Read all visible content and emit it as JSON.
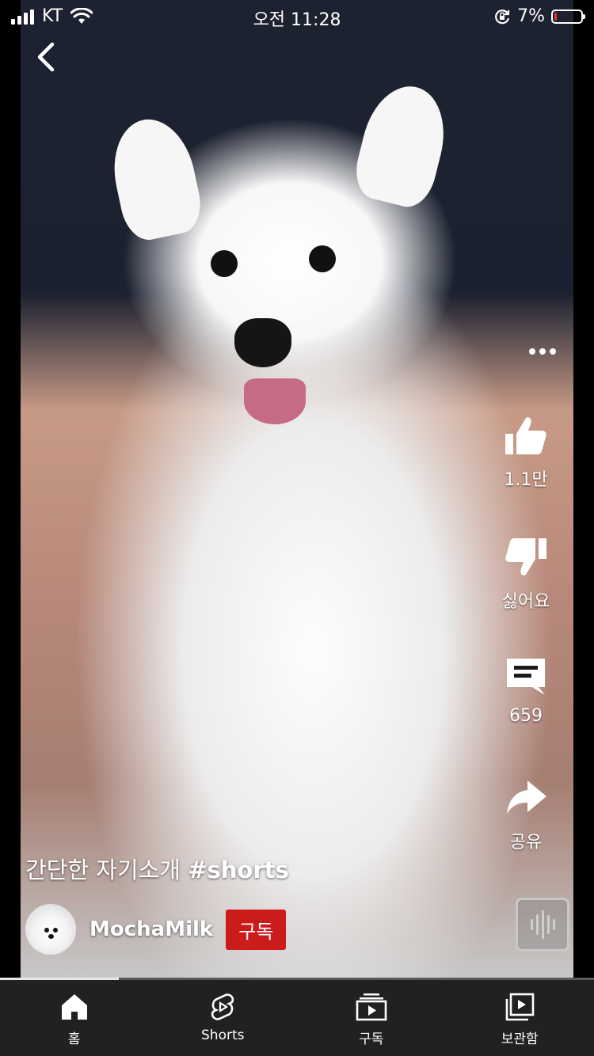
{
  "status_bar": {
    "carrier": "KT",
    "time": "오전 11:28",
    "battery_percent": "7%",
    "battery_level": 0.07
  },
  "actions": {
    "like_count": "1.1만",
    "dislike_label": "싫어요",
    "comment_count": "659",
    "share_label": "공유"
  },
  "video": {
    "caption_text": "간단한 자기소개 ",
    "caption_hashtag": "#shorts",
    "progress": 0.2
  },
  "channel": {
    "name": "MochaMilk",
    "subscribe_label": "구독"
  },
  "nav": {
    "home_label": "홈",
    "shorts_label": "Shorts",
    "subscriptions_label": "구독",
    "library_label": "보관함"
  },
  "colors": {
    "subscribe": "#cc1b1b",
    "navbar": "#212121",
    "battery_low": "#e5322e"
  }
}
